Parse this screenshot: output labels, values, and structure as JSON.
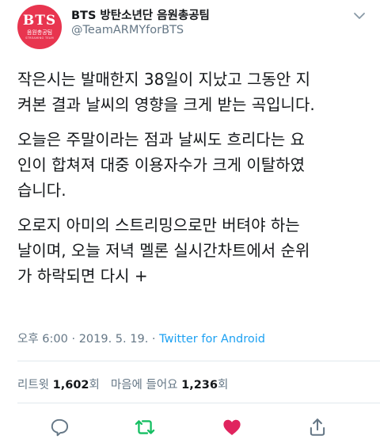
{
  "account": {
    "avatar": {
      "big": "BTS",
      "small": "음원총공팀",
      "tiny": "STREAMING TEAM"
    },
    "display_name": "BTS 방탄소년단 음원총공팀",
    "handle": "@TeamARMYforBTS"
  },
  "tweet": {
    "paragraphs": [
      {
        "lines": [
          "작은시는 발매한지 38일이 지났고 그동안 지",
          "켜본 결과 날씨의 영향을 크게 받는 곡입니다."
        ]
      },
      {
        "lines": [
          "오늘은 주말이라는 점과 날씨도 흐리다는 요",
          "인이 합쳐져 대중 이용자수가 크게 이탈하였",
          "습니다."
        ]
      },
      {
        "lines": [
          "오로지 아미의 스트리밍으로만 버텨야 하는",
          "날이며, 오늘 저녁 멜론 실시간차트에서 순위",
          "가 하락되면 다시 +"
        ]
      }
    ]
  },
  "meta": {
    "time": "오후 6:00",
    "separator1": " · ",
    "date": "2019. 5. 19.",
    "separator2": " · ",
    "source": "Twitter for Android"
  },
  "stats": {
    "retweets_label": "리트윗",
    "retweets_count": "1,602",
    "retweets_unit": "회",
    "likes_label": "마음에 들어요",
    "likes_count": "1,236",
    "likes_unit": "회"
  },
  "actions": {
    "reply_icon": "reply-icon",
    "retweet_icon": "retweet-icon",
    "like_icon": "heart-icon",
    "share_icon": "share-icon"
  },
  "colors": {
    "avatar_bg": "#e8354f",
    "link": "#1da1f2",
    "retweet_active": "#17bf63",
    "like_active": "#e0245e",
    "muted": "#657786"
  }
}
